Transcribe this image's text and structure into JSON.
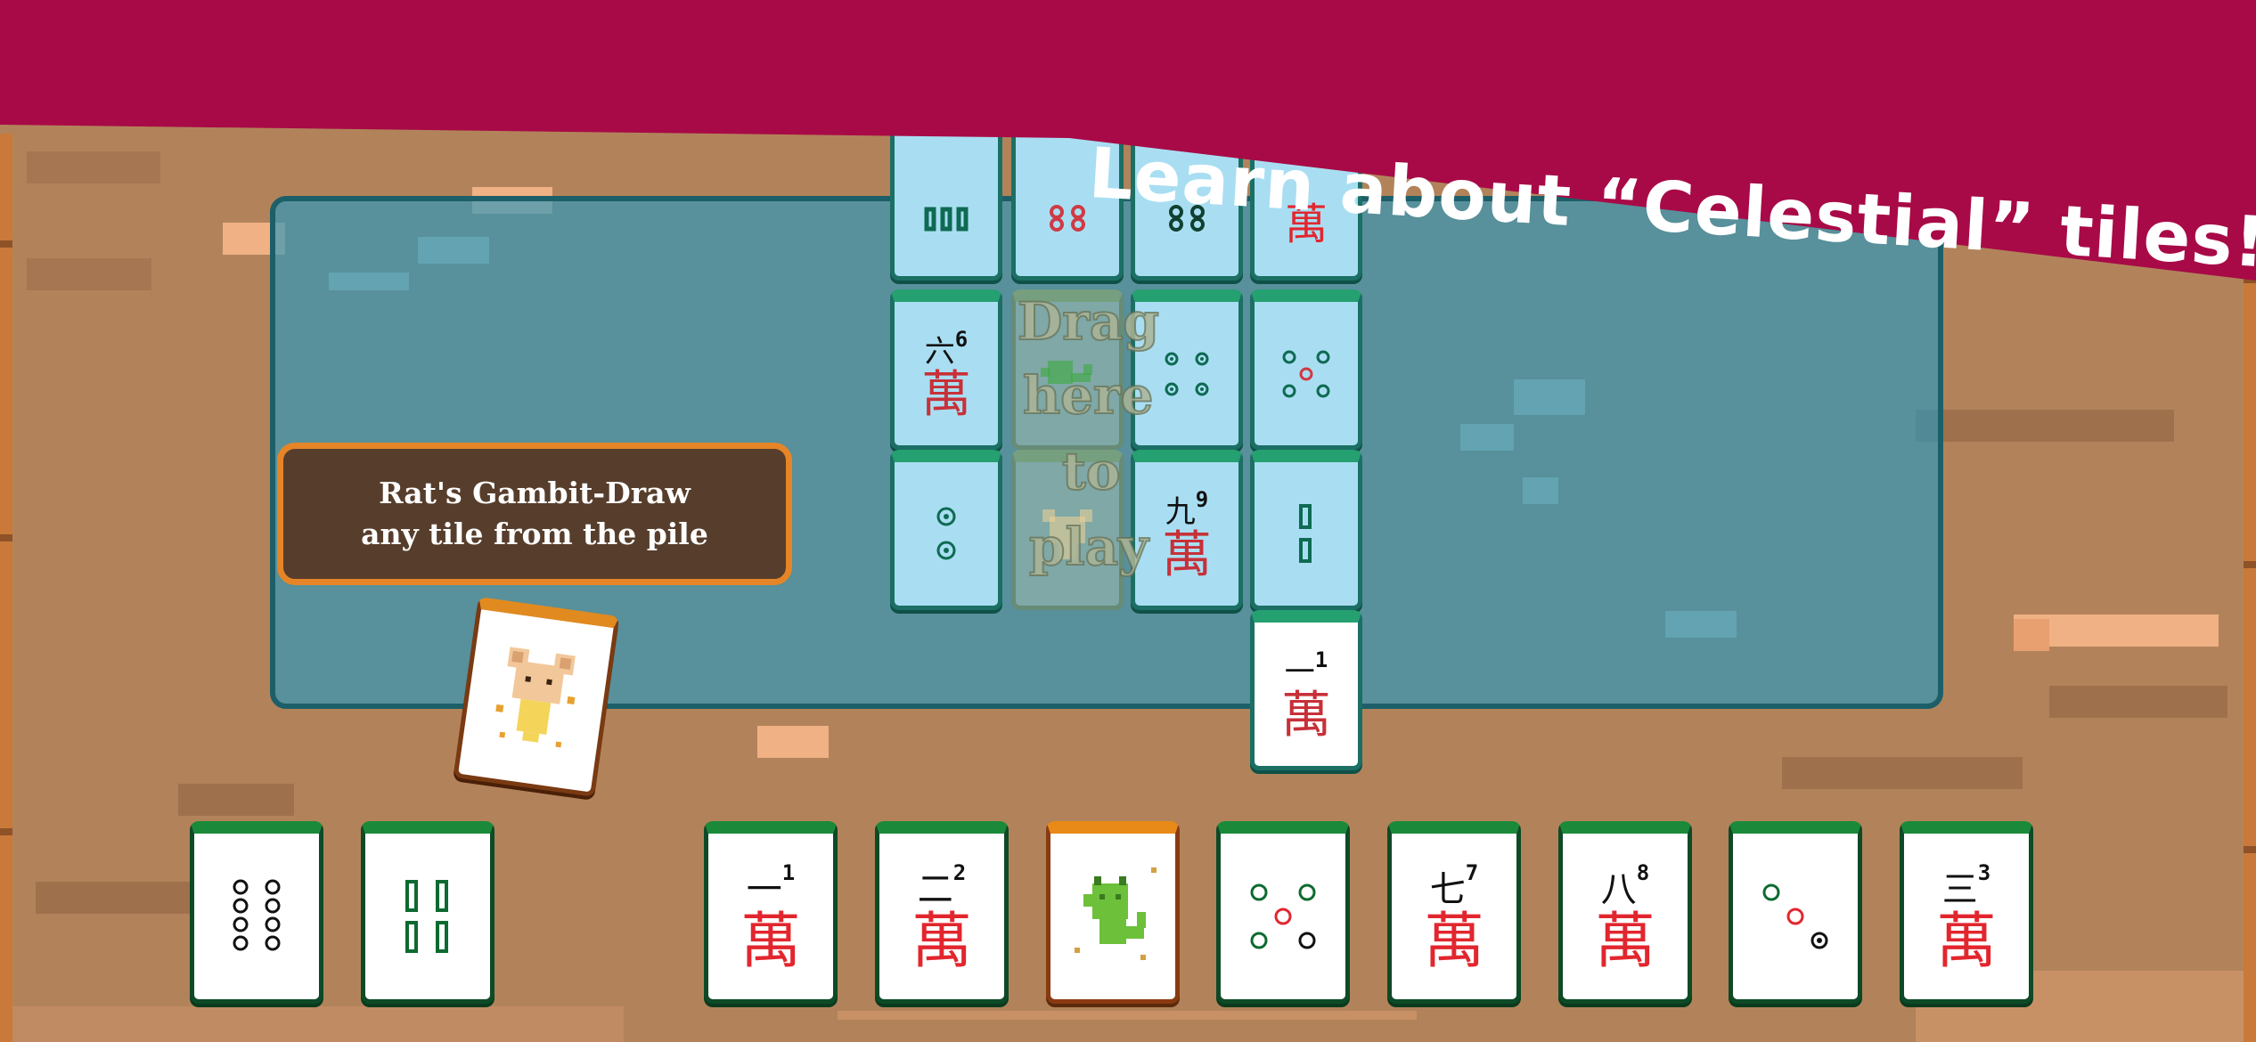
{
  "banner": {
    "title": "Learn about “Celestial” tiles!"
  },
  "tooltip": {
    "line1": "Rat's Gambit-Draw",
    "line2": "any tile from the pile"
  },
  "drop_hint": {
    "words": [
      "Drag",
      "here",
      "to",
      "play"
    ]
  },
  "colors": {
    "banner": "#a80a47",
    "board": "#2896be",
    "tile_frame": "#0d4a26",
    "tile_top": "#1a8a3a",
    "tooltip_bg": "#573e2c",
    "tooltip_border": "#e68527",
    "wan_red": "#e2262e"
  },
  "board_tiles": [
    {
      "id": "b1",
      "kind": "bamboo-3-partial"
    },
    {
      "id": "b2",
      "kind": "circles-partial"
    },
    {
      "id": "b3",
      "kind": "circles-partial"
    },
    {
      "id": "b4",
      "kind": "character-partial"
    },
    {
      "id": "b5",
      "kind": "character",
      "numeral": "六",
      "digit": "6"
    },
    {
      "id": "b6",
      "kind": "ghost-slot"
    },
    {
      "id": "b7",
      "kind": "circles-4"
    },
    {
      "id": "b8",
      "kind": "circles-5"
    },
    {
      "id": "b9",
      "kind": "circles-2"
    },
    {
      "id": "b10",
      "kind": "ghost-slot-rat"
    },
    {
      "id": "b11",
      "kind": "character",
      "numeral": "九",
      "digit": "9"
    },
    {
      "id": "b12",
      "kind": "bamboo-2"
    },
    {
      "id": "b13",
      "kind": "character",
      "numeral": "一",
      "digit": "1"
    }
  ],
  "hand_tiles": [
    {
      "id": "h1",
      "kind": "circles-8"
    },
    {
      "id": "h2",
      "kind": "bamboo-4"
    },
    {
      "id": "h3",
      "kind": "character",
      "numeral": "一",
      "digit": "1"
    },
    {
      "id": "h4",
      "kind": "character",
      "numeral": "二",
      "digit": "2"
    },
    {
      "id": "h5",
      "kind": "celestial-dragon"
    },
    {
      "id": "h6",
      "kind": "circles-5"
    },
    {
      "id": "h7",
      "kind": "character",
      "numeral": "七",
      "digit": "7"
    },
    {
      "id": "h8",
      "kind": "character",
      "numeral": "八",
      "digit": "8"
    },
    {
      "id": "h9",
      "kind": "circles-3"
    },
    {
      "id": "h10",
      "kind": "character",
      "numeral": "三",
      "digit": "3"
    }
  ],
  "selected_card": {
    "kind": "celestial-rat"
  },
  "glyphs": {
    "wan": "萬"
  }
}
